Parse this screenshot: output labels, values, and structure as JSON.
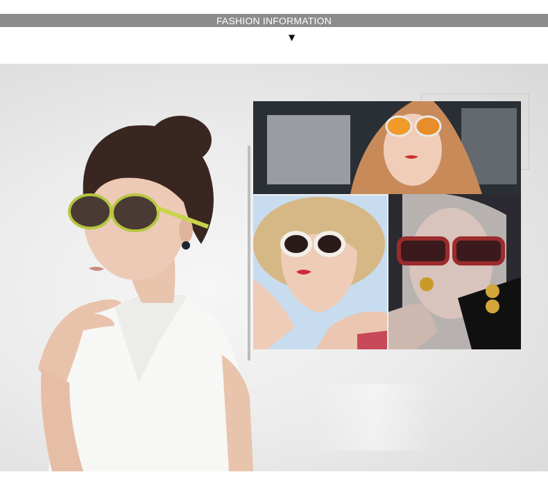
{
  "header": {
    "title": "FASHION INFORMATION",
    "arrow_icon": "triangle-down-icon",
    "bar_color": "#8c8c8c"
  },
  "banner": {
    "background_color": "#ececec",
    "photos": [
      {
        "subject": "woman-in-car-mirrored-sunglasses"
      },
      {
        "subject": "woman-in-straw-hat-white-sunglasses"
      },
      {
        "subject": "woman-leopard-sunglasses-gold-necklace"
      }
    ]
  }
}
